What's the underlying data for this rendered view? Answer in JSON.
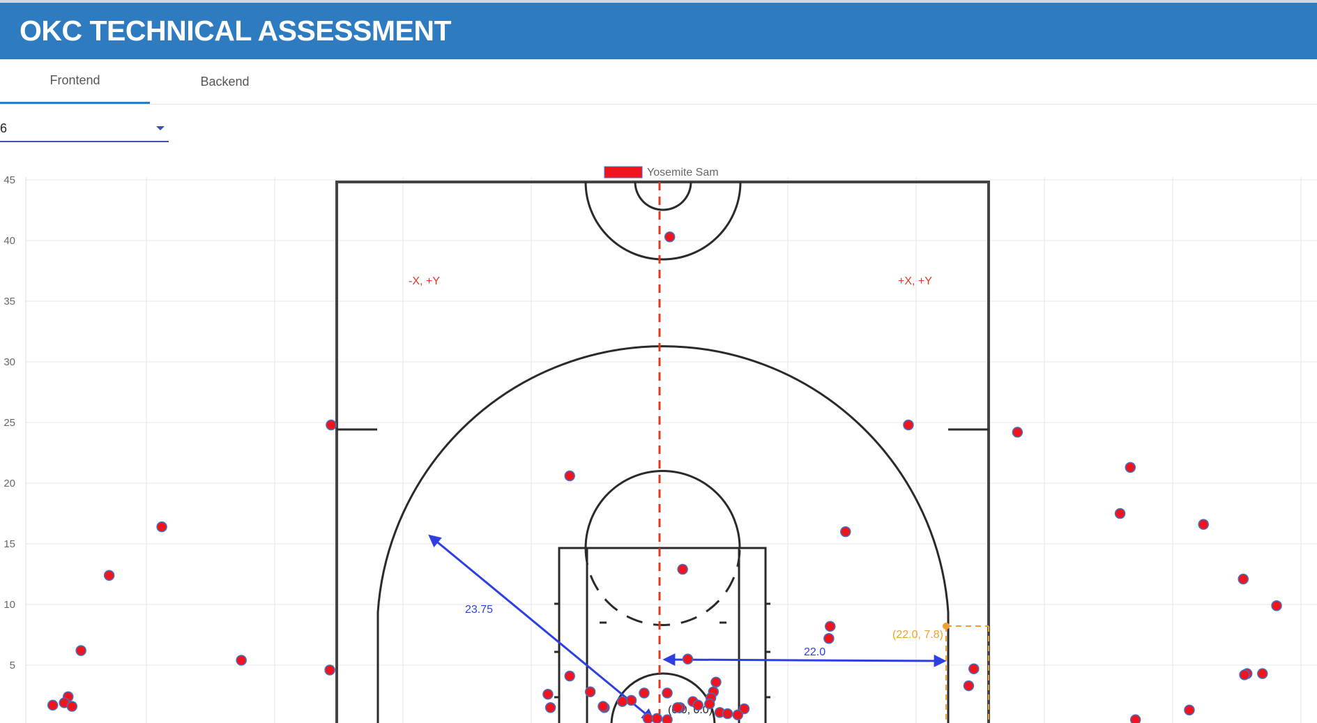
{
  "header": {
    "title": "OKC TECHNICAL ASSESSMENT"
  },
  "tabs": [
    {
      "label": "Frontend",
      "active": true
    },
    {
      "label": "Backend",
      "active": false
    }
  ],
  "selector": {
    "value": "6"
  },
  "colors": {
    "accent": "#2e7bc0",
    "shot": "#f0141e",
    "shot_outline": "#3f72c4",
    "midline": "#e0381f",
    "measure": "#2d3fe0",
    "corner": "#f0a030"
  },
  "chart_data": {
    "type": "scatter",
    "legend": {
      "label": "Yosemite Sam",
      "position": "top-center"
    },
    "xlim": [
      -25.5,
      25.5
    ],
    "ylim": [
      0,
      45
    ],
    "y_ticks": [
      5,
      10,
      15,
      20,
      25,
      30,
      35,
      40,
      45
    ],
    "grid": true,
    "annotations": {
      "quadrant_left": "-X, +Y",
      "quadrant_right": "+X, +Y",
      "arc_radius_label": "23.75",
      "corner_distance_label": "22.0",
      "corner_point_label": "(22.0, 7.8)",
      "origin_label": "(0.0, 0.0)"
    },
    "series": [
      {
        "name": "Yosemite Sam",
        "points": [
          [
            0.8,
            40.3
          ],
          [
            -7.0,
            20.6
          ],
          [
            -25.6,
            24.8
          ],
          [
            19.4,
            24.8
          ],
          [
            27.9,
            24.2
          ],
          [
            36.7,
            21.3
          ],
          [
            35.9,
            17.5
          ],
          [
            42.4,
            16.6
          ],
          [
            -38.8,
            16.4
          ],
          [
            14.5,
            16.0
          ],
          [
            1.8,
            12.9
          ],
          [
            -42.9,
            12.4
          ],
          [
            45.5,
            12.1
          ],
          [
            48.1,
            9.9
          ],
          [
            13.3,
            8.2
          ],
          [
            13.2,
            7.2
          ],
          [
            -45.1,
            6.2
          ],
          [
            -32.6,
            5.4
          ],
          [
            2.2,
            5.5
          ],
          [
            -25.7,
            4.6
          ],
          [
            24.5,
            4.7
          ],
          [
            45.8,
            4.3
          ],
          [
            45.6,
            4.2
          ],
          [
            47.0,
            4.3
          ],
          [
            -7.0,
            4.1
          ],
          [
            24.1,
            3.3
          ],
          [
            4.4,
            3.6
          ],
          [
            4.2,
            2.8
          ],
          [
            -5.4,
            2.8
          ],
          [
            -1.2,
            2.7
          ],
          [
            0.6,
            2.7
          ],
          [
            4.0,
            2.3
          ],
          [
            -2.2,
            2.1
          ],
          [
            -8.7,
            2.6
          ],
          [
            -46.1,
            2.4
          ],
          [
            -46.4,
            1.9
          ],
          [
            -47.3,
            1.7
          ],
          [
            -45.8,
            1.6
          ],
          [
            -8.5,
            1.5
          ],
          [
            -4.3,
            1.5
          ],
          [
            -2.9,
            2.0
          ],
          [
            -4.4,
            1.6
          ],
          [
            2.6,
            2.0
          ],
          [
            3.0,
            1.7
          ],
          [
            1.6,
            1.5
          ],
          [
            3.9,
            1.8
          ],
          [
            6.6,
            1.4
          ],
          [
            -0.9,
            0.6
          ],
          [
            -0.2,
            0.6
          ],
          [
            0.6,
            0.5
          ],
          [
            1.4,
            1.5
          ],
          [
            4.7,
            1.1
          ],
          [
            5.3,
            1.0
          ],
          [
            6.1,
            0.9
          ],
          [
            41.3,
            1.3
          ],
          [
            37.1,
            0.5
          ]
        ]
      }
    ]
  }
}
